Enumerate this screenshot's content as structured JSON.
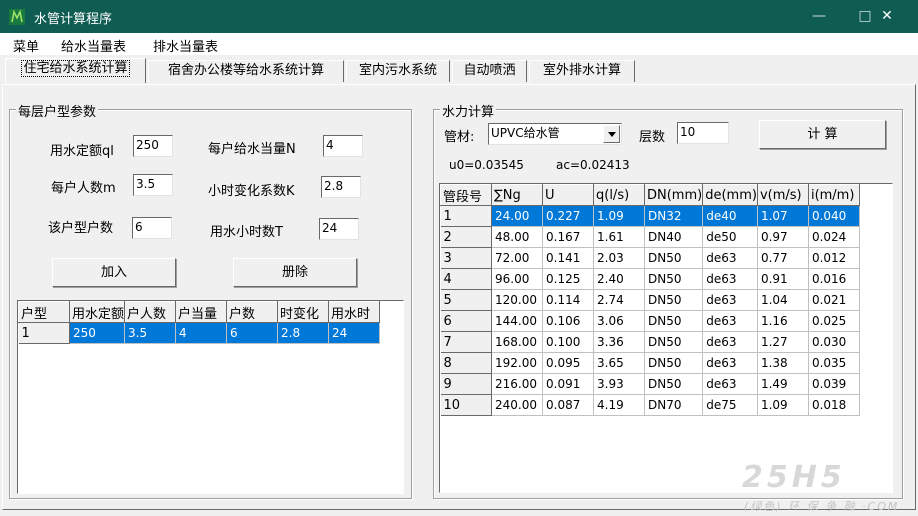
{
  "window": {
    "title": "水管计算程序",
    "minimize": "—",
    "maximize": "□",
    "close": "✕"
  },
  "menu": [
    "菜单",
    "给水当量表",
    "排水当量表"
  ],
  "tabs": [
    "住宅给水系统计算",
    "宿舍办公楼等给水系统计算",
    "室内污水系统",
    "自动喷洒",
    "室外排水计算"
  ],
  "left": {
    "legend": "每层户型参数",
    "fields": {
      "quota_label": "用水定额ql",
      "quota_value": "250",
      "eq_label": "每户给水当量N",
      "eq_value": "4",
      "persons_label": "每户人数m",
      "persons_value": "3.5",
      "k_label": "小时变化系数K",
      "k_value": "2.8",
      "units_label": "该户型户数",
      "units_value": "6",
      "hours_label": "用水小时数T",
      "hours_value": "24"
    },
    "add_button": "加入",
    "delete_button": "册除",
    "table": {
      "columns": [
        "户型",
        "用水定额",
        "户人数",
        "户当量",
        "户数",
        "时变化",
        "用水时"
      ],
      "rows": [
        [
          "1",
          "250",
          "3.5",
          "4",
          "6",
          "2.8",
          "24"
        ]
      ]
    }
  },
  "right": {
    "legend": "水力计算",
    "material_label": "管材:",
    "material_value": "UPVC给水管",
    "floors_label": "层数",
    "floors_value": "10",
    "calc_button": "计 算",
    "u0": "u0=0.03545",
    "ac": "ac=0.02413",
    "table": {
      "columns": [
        "管段号",
        "∑Ng",
        "U",
        "q(l/s)",
        "DN(mm)",
        "de(mm)",
        "v(m/s)",
        "i(m/m)"
      ],
      "rows": [
        [
          "1",
          "24.00",
          "0.227",
          "1.09",
          "DN32",
          "de40",
          "1.07",
          "0.040"
        ],
        [
          "2",
          "48.00",
          "0.167",
          "1.61",
          "DN40",
          "de50",
          "0.97",
          "0.024"
        ],
        [
          "3",
          "72.00",
          "0.141",
          "2.03",
          "DN50",
          "de63",
          "0.77",
          "0.012"
        ],
        [
          "4",
          "96.00",
          "0.125",
          "2.40",
          "DN50",
          "de63",
          "0.91",
          "0.016"
        ],
        [
          "5",
          "120.00",
          "0.114",
          "2.74",
          "DN50",
          "de63",
          "1.04",
          "0.021"
        ],
        [
          "6",
          "144.00",
          "0.106",
          "3.06",
          "DN50",
          "de63",
          "1.16",
          "0.025"
        ],
        [
          "7",
          "168.00",
          "0.100",
          "3.36",
          "DN50",
          "de63",
          "1.27",
          "0.030"
        ],
        [
          "8",
          "192.00",
          "0.095",
          "3.65",
          "DN50",
          "de63",
          "1.38",
          "0.035"
        ],
        [
          "9",
          "216.00",
          "0.091",
          "3.93",
          "DN50",
          "de63",
          "1.49",
          "0.039"
        ],
        [
          "10",
          "240.00",
          "0.087",
          "4.19",
          "DN70",
          "de75",
          "1.09",
          "0.018"
        ]
      ]
    }
  },
  "watermark": {
    "logo": "25H5",
    "sub": "(绿色) 环 保 争 融 ·COM"
  },
  "colors": {
    "titlebar": "#0f5c52",
    "selection": "#0078d7",
    "face": "#f0f0f0"
  }
}
